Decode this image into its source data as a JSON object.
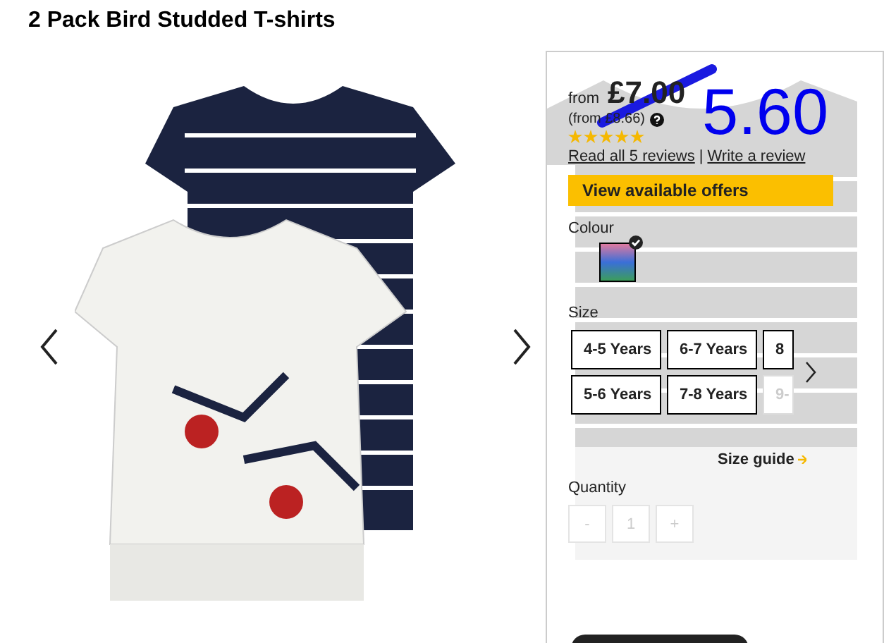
{
  "title": "2 Pack Bird Studded T-shirts",
  "price": {
    "from_label": "from",
    "was": "£7.00",
    "from_note": "(from £8.66)",
    "new_price": "5.60",
    "stars": 5,
    "reviews_link": "Read all 5 reviews",
    "separator": "|",
    "write_link": "Write a review"
  },
  "offers_button": "View available offers",
  "colour": {
    "label": "Colour",
    "swatches": [
      {
        "selected": true
      }
    ]
  },
  "size": {
    "label": "Size",
    "options": [
      {
        "label": "4-5 Years",
        "disabled": false
      },
      {
        "label": "6-7 Years",
        "disabled": false
      },
      {
        "label": "8",
        "disabled": false
      },
      {
        "label": "5-6 Years",
        "disabled": false
      },
      {
        "label": "7-8 Years",
        "disabled": false
      },
      {
        "label": "9-",
        "disabled": true
      }
    ]
  },
  "size_guide": "Size guide",
  "quantity": {
    "label": "Quantity",
    "minus": "-",
    "value": "1",
    "plus": "+"
  }
}
